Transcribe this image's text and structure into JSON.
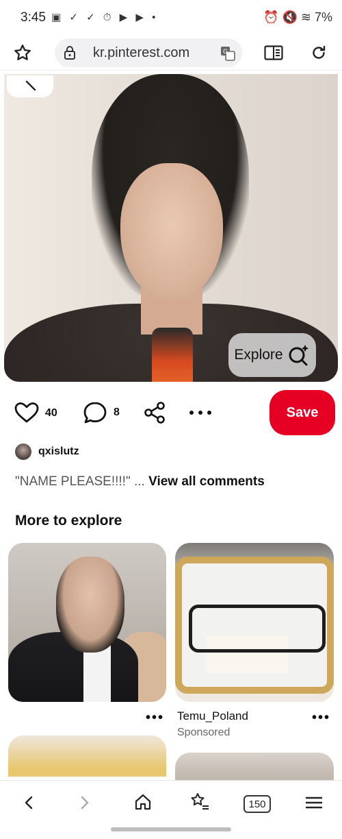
{
  "status_bar": {
    "time": "3:45",
    "battery": "7%"
  },
  "browser": {
    "url": "kr.pinterest.com"
  },
  "pin": {
    "explore_label": "Explore",
    "like_count": "40",
    "comment_count": "8",
    "save_label": "Save",
    "username": "qxislutz",
    "comment_text": "\"NAME PLEASE!!!!\"",
    "comment_ellipsis": "...",
    "view_comments": "View all comments"
  },
  "more_section": {
    "title": "More to explore",
    "cards": [
      {
        "more": "•••"
      },
      {
        "more": "•••",
        "name": "Temu_Poland",
        "tag": "Sponsored"
      }
    ]
  },
  "bottom_nav": {
    "tab_count": "150"
  },
  "colors": {
    "save": "#e60023"
  }
}
